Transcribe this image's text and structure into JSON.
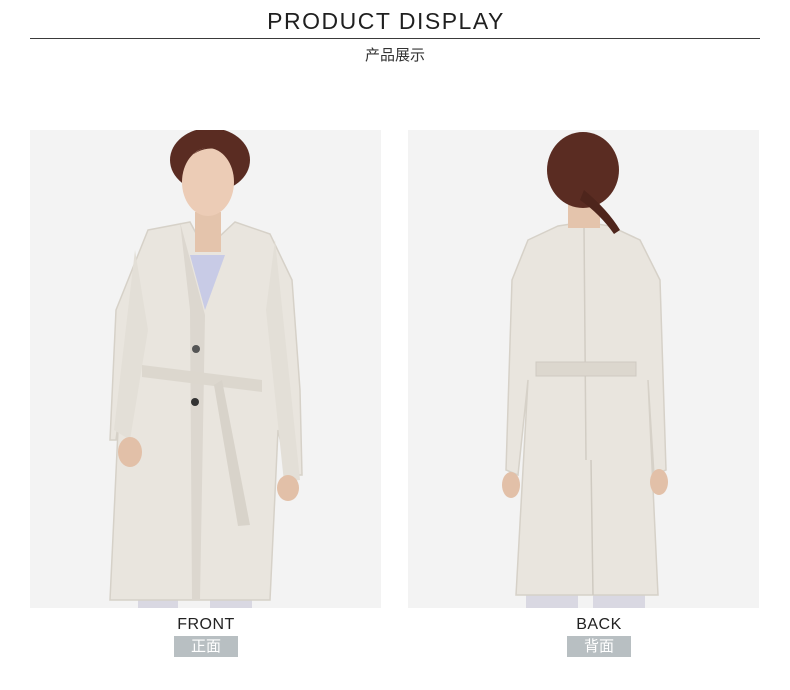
{
  "header": {
    "title": "PRODUCT DISPLAY",
    "subtitle": "产品展示"
  },
  "views": [
    {
      "label": "FRONT",
      "label_cn": "正面",
      "image_desc": "model-front"
    },
    {
      "label": "BACK",
      "label_cn": "背面",
      "image_desc": "model-back"
    }
  ],
  "colors": {
    "caption_badge": "#b8bfc2",
    "coat": "#e8e4dc",
    "background": "#f2f2f2"
  }
}
